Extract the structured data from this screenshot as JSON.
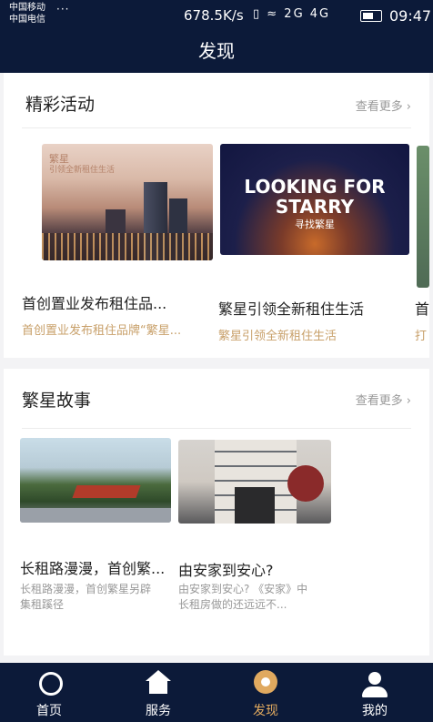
{
  "status_bar": {
    "carrier_1": "中国移动",
    "carrier_2": "中国电信",
    "dots": "···",
    "network_speed": "678.5K/s",
    "signal_icons": "▯ ≈ 2G 4G",
    "time": "09:47"
  },
  "header": {
    "title": "发现"
  },
  "activities": {
    "title": "精彩活动",
    "more_label": "查看更多",
    "cards": [
      {
        "image_text_1": "繁星",
        "image_text_2": "引领全新租住生活",
        "title": "首创置业发布租住品...",
        "subtitle": "首创置业发布租住品牌“繁星..."
      },
      {
        "image_text_1": "LOOKING FOR",
        "image_text_2": "STARRY",
        "image_text_3": "寻找繁星",
        "title": "繁星引领全新租住生活",
        "subtitle": "繁星引领全新租住生活"
      },
      {
        "title": "首",
        "subtitle": "打"
      }
    ]
  },
  "stories": {
    "title": "繁星故事",
    "more_label": "查看更多",
    "cards": [
      {
        "title": "长租路漫漫，首创繁...",
        "subtitle": "长租路漫漫，首创繁星另辟集租蹊径"
      },
      {
        "title": "由安家到安心?",
        "subtitle": "由安家到安心? 《安家》中长租房做的还远远不..."
      }
    ]
  },
  "tabbar": {
    "items": [
      {
        "label": "首页",
        "icon": "planet-icon",
        "active": false
      },
      {
        "label": "服务",
        "icon": "house-icon",
        "active": false
      },
      {
        "label": "发现",
        "icon": "discover-icon",
        "active": true
      },
      {
        "label": "我的",
        "icon": "user-icon",
        "active": false
      }
    ]
  },
  "colors": {
    "navy": "#0c1a39",
    "gold_accent": "#e0a95f",
    "subtitle_gold": "#c8a06a"
  }
}
